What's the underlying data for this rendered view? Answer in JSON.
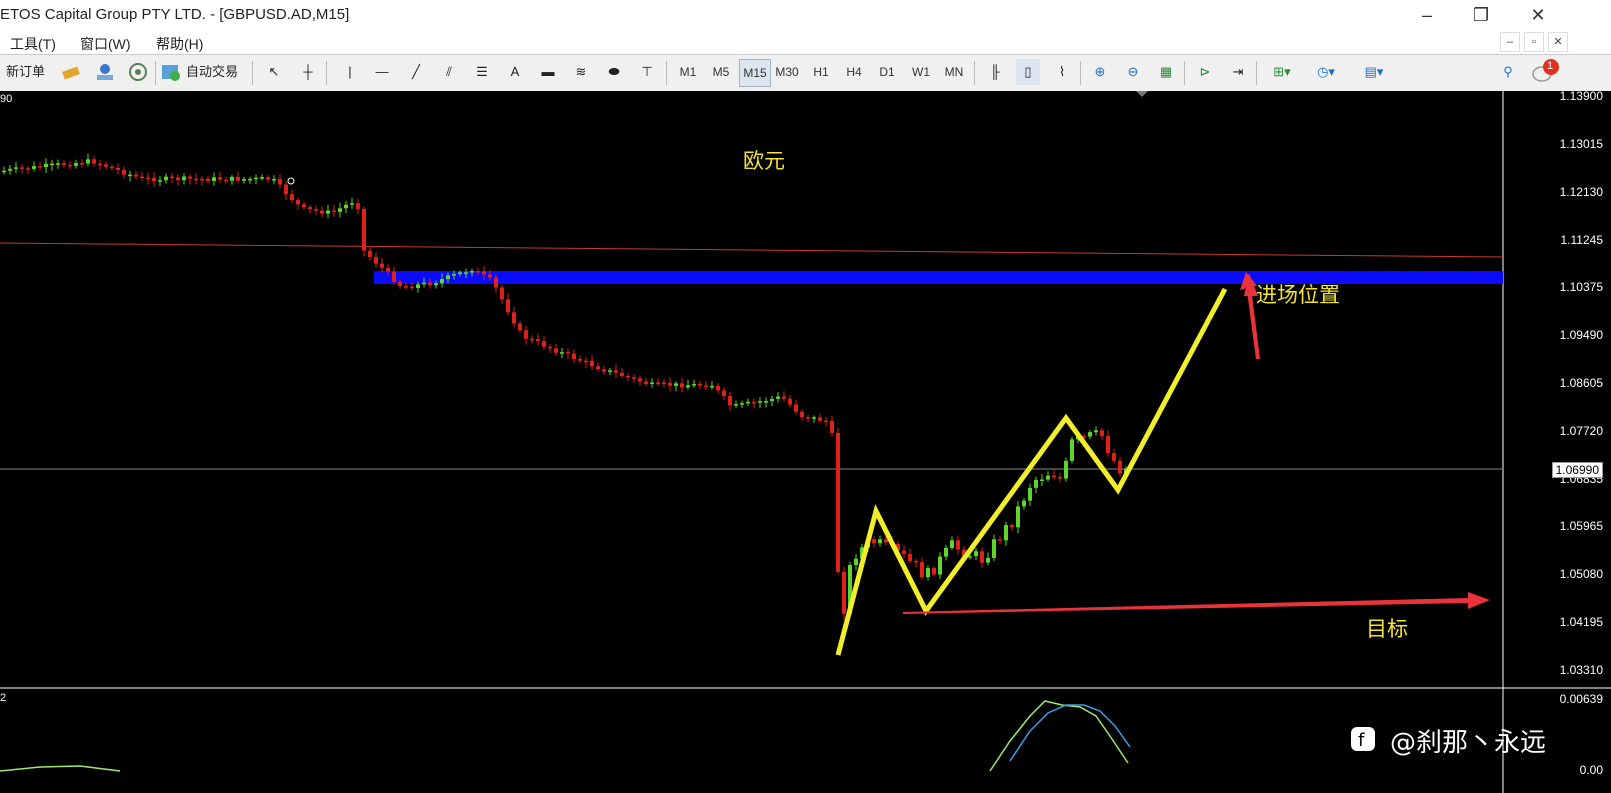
{
  "window": {
    "title": "ETOS Capital Group PTY LTD. - [GBPUSD.AD,M15]",
    "minimize": "–",
    "maximize": "❐",
    "close": "✕"
  },
  "menu": {
    "items": [
      "工具(T)",
      "窗口(W)",
      "帮助(H)"
    ],
    "mdi_minimize": "–",
    "mdi_restore": "▫",
    "mdi_close": "✕"
  },
  "toolbar": {
    "new_order": "新订单",
    "auto_trade": "自动交易",
    "timeframes": [
      "M1",
      "M5",
      "M15",
      "M30",
      "H1",
      "H4",
      "D1",
      "W1",
      "MN"
    ],
    "active_timeframe": "M15",
    "notification_count": "1"
  },
  "chart": {
    "price_axis": [
      "1.13900",
      "1.13015",
      "1.12130",
      "1.11245",
      "1.10375",
      "1.09490",
      "1.08605",
      "1.07720",
      "1.06835",
      "1.05965",
      "1.05080",
      "1.04195",
      "1.03310"
    ],
    "current_price": "1.06990",
    "top_left_label": "90",
    "indicator_axis_top": "0.00639",
    "indicator_axis_bottom": "0.00",
    "indicator_left_label": "2",
    "colors": {
      "up_candle": "#5cd62c",
      "down_candle": "#e0201a",
      "zone": "#0a0aff",
      "zigzag": "#f2ee2a",
      "arrow": "#e8333a",
      "ma_line": "#c8392d"
    }
  },
  "annotations": {
    "title": "欧元",
    "entry": "进场位置",
    "target": "目标"
  },
  "watermark": "@刹那丶永远"
}
